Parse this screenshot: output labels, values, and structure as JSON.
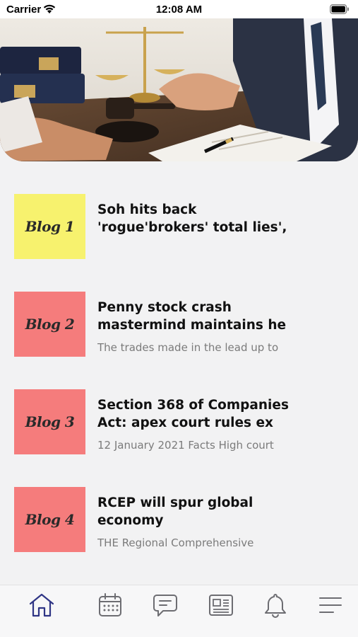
{
  "status_bar": {
    "carrier": "Carrier",
    "time": "12:08 AM"
  },
  "hero": {
    "image": "lawyer-desk-scales-gavel"
  },
  "blogs": [
    {
      "thumb_label": "Blog 1",
      "thumb_color": "#f7f26e",
      "title_line1": "Soh hits back",
      "title_line2": "'rogue'brokers' total lies',",
      "excerpt": ""
    },
    {
      "thumb_label": "Blog 2",
      "thumb_color": "#f57c7c",
      "title_line1": "Penny stock crash",
      "title_line2": "mastermind maintains he",
      "excerpt": "The trades made in the lead up to"
    },
    {
      "thumb_label": "Blog 3",
      "thumb_color": "#f57c7c",
      "title_line1": "Section 368 of Companies",
      "title_line2": "Act: apex court rules ex",
      "excerpt": "12 January 2021 Facts  High court"
    },
    {
      "thumb_label": "Blog 4",
      "thumb_color": "#f57c7c",
      "title_line1": "RCEP will spur global",
      "title_line2": "economy",
      "excerpt": "THE Regional Comprehensive"
    }
  ],
  "tab_bar": {
    "active_color": "#2f3585",
    "inactive_color": "#6d6d72",
    "tabs": [
      {
        "icon": "home-icon",
        "active": true
      },
      {
        "icon": "calendar-icon",
        "active": false
      },
      {
        "icon": "chat-icon",
        "active": false
      },
      {
        "icon": "newspaper-icon",
        "active": false
      },
      {
        "icon": "bell-icon",
        "active": false
      },
      {
        "icon": "menu-icon",
        "active": false
      }
    ]
  }
}
